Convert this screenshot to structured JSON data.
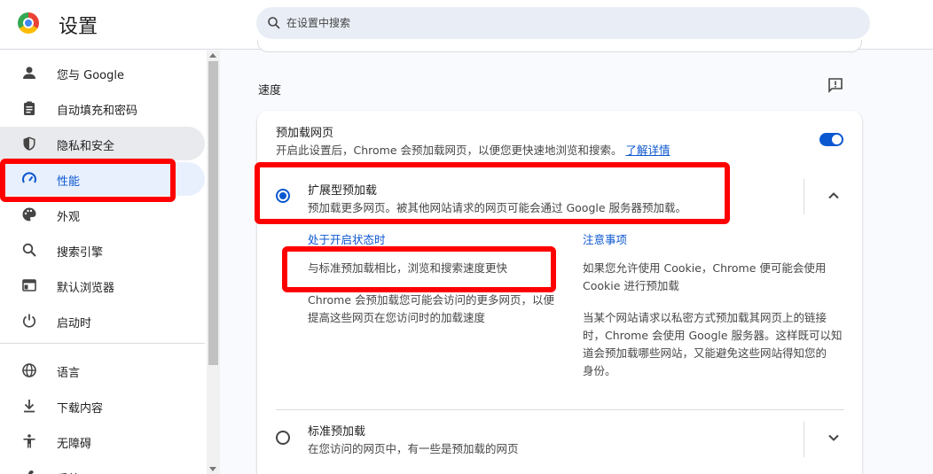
{
  "header": {
    "title": "设置",
    "search_placeholder": "在设置中搜索"
  },
  "sidebar": {
    "items": [
      {
        "label": "您与 Google",
        "icon": "person-icon"
      },
      {
        "label": "自动填充和密码",
        "icon": "clipboard-icon"
      },
      {
        "label": "隐私和安全",
        "icon": "shield-icon"
      },
      {
        "label": "性能",
        "icon": "speedometer-icon"
      },
      {
        "label": "外观",
        "icon": "palette-icon"
      },
      {
        "label": "搜索引擎",
        "icon": "search-icon"
      },
      {
        "label": "默认浏览器",
        "icon": "browser-icon"
      },
      {
        "label": "启动时",
        "icon": "power-icon"
      },
      {
        "label": "语言",
        "icon": "globe-icon"
      },
      {
        "label": "下载内容",
        "icon": "download-icon"
      },
      {
        "label": "无障碍",
        "icon": "accessibility-icon"
      },
      {
        "label": "系统",
        "icon": "wrench-icon"
      }
    ]
  },
  "main": {
    "section_title": "速度",
    "preload": {
      "title": "预加载网页",
      "description": "开启此设置后，Chrome 会预加载网页，以便您更快速地浏览和搜索。",
      "learn_more": "了解详情",
      "enabled": true
    },
    "extended": {
      "title": "扩展型预加载",
      "description": "预加载更多网页。被其他网站请求的网页可能会通过 Google 服务器预加载。",
      "selected": true,
      "when_on_heading": "处于开启状态时",
      "when_on_point1": "与标准预加载相比，浏览和搜索速度更快",
      "when_on_point2_line1": "Chrome 会预加载您可能会访问的更多网页，以便",
      "when_on_point2_line2": "提高这些网页在您访问时的加载速度",
      "notes_heading": "注意事项",
      "notes_point1_line1": "如果您允许使用 Cookie，Chrome 便可能会使用",
      "notes_point1_line2": "Cookie 进行预加载",
      "notes_point2_line1": "当某个网站请求以私密方式预加载其网页上的链接",
      "notes_point2_line2": "时，Chrome 会使用 Google 服务器。这样既可以知",
      "notes_point2_line3": "道会预加载哪些网站，又能避免这些网站得知您的",
      "notes_point2_line4": "身份。"
    },
    "standard": {
      "title": "标准预加载",
      "description": "在您访问的网页中，有一些是预加载的网页",
      "selected": false
    }
  },
  "colors": {
    "accent": "#0b57d0",
    "highlight": "#ff0000"
  }
}
